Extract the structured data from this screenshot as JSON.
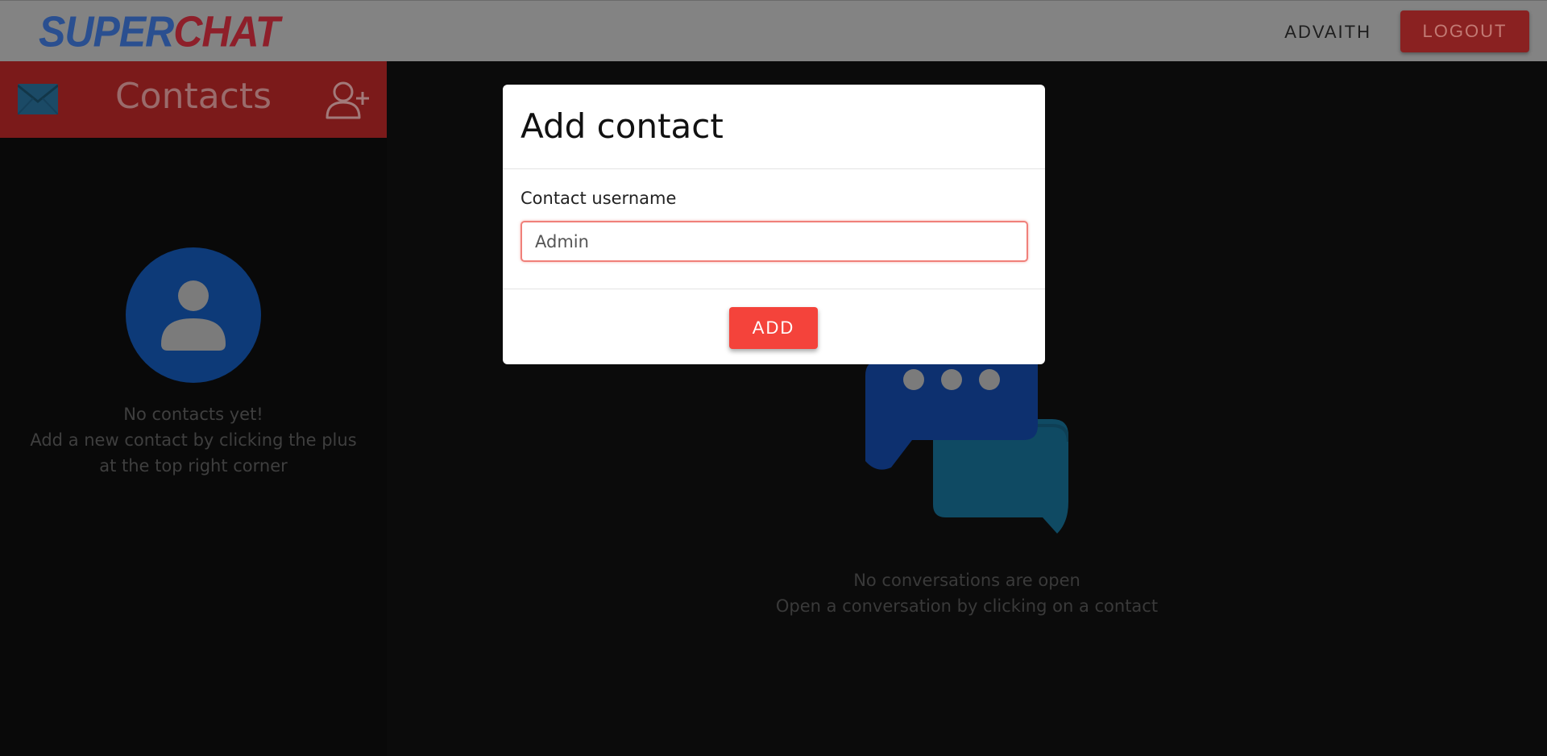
{
  "header": {
    "logo_part1": "SUPER",
    "logo_part2": "CHAT",
    "username": "ADVAITH",
    "logout_label": "LOGOUT"
  },
  "sidebar": {
    "title": "Contacts",
    "mail_icon": "mail-icon",
    "add_contact_icon": "add-user-icon",
    "empty_line1": "No contacts yet!",
    "empty_line2": "Add a new contact by clicking the plus",
    "empty_line3": "at the top right corner"
  },
  "main": {
    "empty_line1": "No conversations are open",
    "empty_line2": "Open a conversation by clicking on a contact"
  },
  "modal": {
    "title": "Add contact",
    "field_label": "Contact username",
    "input_value": "Admin",
    "add_label": "ADD"
  },
  "colors": {
    "accent_red": "#f4433b",
    "dim_red": "#7b1a1a",
    "brand_blue": "#2a4f90"
  }
}
